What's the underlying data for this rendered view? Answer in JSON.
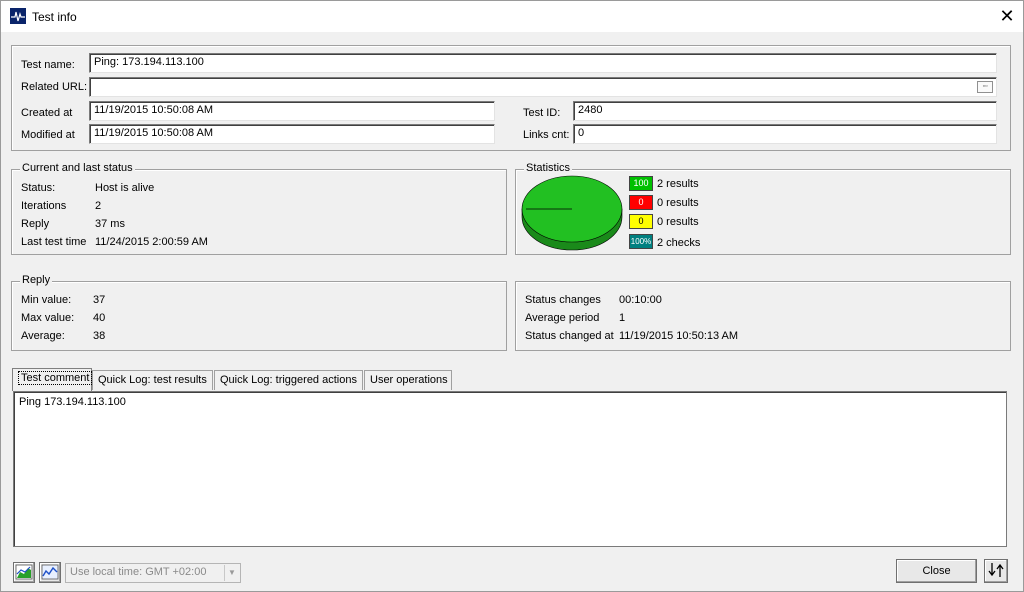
{
  "window": {
    "title": "Test info"
  },
  "header": {
    "test_name_label": "Test name:",
    "test_name_value": "Ping: 173.194.113.100",
    "related_url_label": "Related URL:",
    "related_url_value": "",
    "created_at_label": "Created at",
    "created_at_value": "11/19/2015 10:50:08 AM",
    "modified_at_label": "Modified at",
    "modified_at_value": "11/19/2015 10:50:08 AM",
    "test_id_label": "Test ID:",
    "test_id_value": "2480",
    "links_cnt_label": "Links cnt:",
    "links_cnt_value": "0"
  },
  "status": {
    "group_title": "Current and last status",
    "status_label": "Status:",
    "status_value": "Host is alive",
    "iterations_label": "Iterations",
    "iterations_value": "2",
    "reply_label": "Reply",
    "reply_value": "37 ms",
    "last_test_label": "Last test time",
    "last_test_value": "11/24/2015 2:00:59 AM"
  },
  "statistics": {
    "group_title": "Statistics",
    "legend": [
      {
        "box": "100",
        "text": "2 results",
        "color": "#00c000"
      },
      {
        "box": "0",
        "text": "0 results",
        "color": "#ff0000"
      },
      {
        "box": "0",
        "text": "0 results",
        "color": "#ffff00"
      },
      {
        "box": "100%",
        "text": "2 checks",
        "color": "#008080"
      }
    ],
    "pie_color": "#22c022"
  },
  "reply": {
    "group_title": "Reply",
    "min_label": "Min value:",
    "min_value": "37",
    "max_label": "Max value:",
    "max_value": "40",
    "avg_label": "Average:",
    "avg_value": "38"
  },
  "changes": {
    "status_changes_label": "Status changes",
    "status_changes_value": "00:10:00",
    "average_period_label": "Average period",
    "average_period_value": "1",
    "status_changed_at_label": "Status changed at",
    "status_changed_at_value": "11/19/2015 10:50:13 AM"
  },
  "tabs": [
    {
      "label": "Test comment"
    },
    {
      "label": "Quick Log: test results"
    },
    {
      "label": "Quick Log: triggered actions"
    },
    {
      "label": "User operations"
    }
  ],
  "comment_text": "Ping 173.194.113.100",
  "footer": {
    "timezone_value": "Use local time: GMT +02:00",
    "close_label": "Close"
  }
}
